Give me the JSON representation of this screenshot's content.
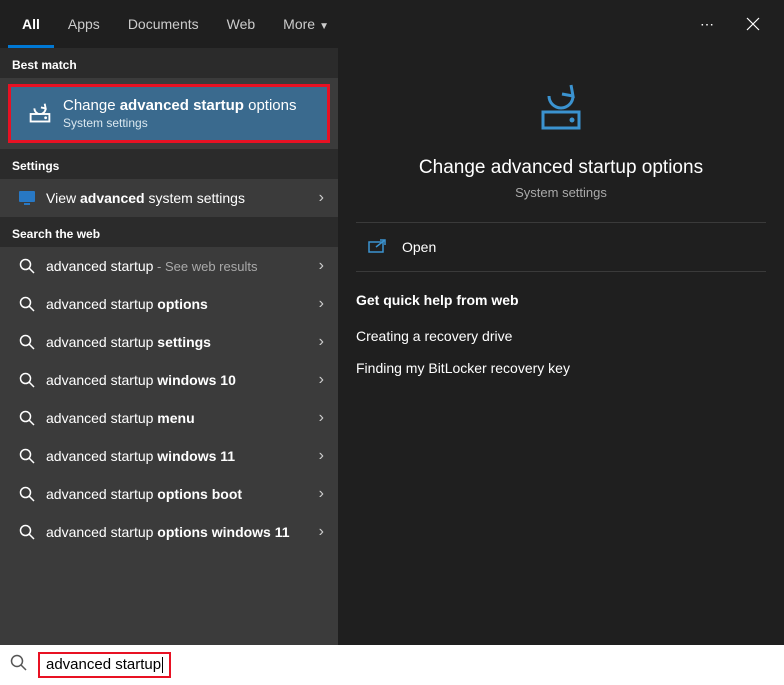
{
  "tabs": [
    "All",
    "Apps",
    "Documents",
    "Web",
    "More"
  ],
  "active_tab": "All",
  "sections": {
    "best": "Best match",
    "settings": "Settings",
    "web": "Search the web"
  },
  "best_match": {
    "title_parts": [
      [
        "Change ",
        false
      ],
      [
        "advanced startup",
        true
      ],
      [
        " options",
        false
      ]
    ],
    "subtitle": "System settings"
  },
  "settings_items": [
    {
      "parts": [
        [
          "View ",
          false
        ],
        [
          "advanced",
          true
        ],
        [
          " system settings",
          false
        ]
      ]
    }
  ],
  "web_items": [
    {
      "parts": [
        [
          "advanced startup",
          false
        ]
      ],
      "hint": " - See web results"
    },
    {
      "parts": [
        [
          "advanced startup ",
          false
        ],
        [
          "options",
          true
        ]
      ]
    },
    {
      "parts": [
        [
          "advanced startup ",
          false
        ],
        [
          "settings",
          true
        ]
      ]
    },
    {
      "parts": [
        [
          "advanced startup ",
          false
        ],
        [
          "windows 10",
          true
        ]
      ]
    },
    {
      "parts": [
        [
          "advanced startup ",
          false
        ],
        [
          "menu",
          true
        ]
      ]
    },
    {
      "parts": [
        [
          "advanced startup ",
          false
        ],
        [
          "windows 11",
          true
        ]
      ]
    },
    {
      "parts": [
        [
          "advanced startup ",
          false
        ],
        [
          "options boot",
          true
        ]
      ]
    },
    {
      "parts": [
        [
          "advanced startup ",
          false
        ],
        [
          "options windows 11",
          true
        ]
      ]
    }
  ],
  "preview": {
    "title": "Change advanced startup options",
    "subtitle": "System settings",
    "open_label": "Open",
    "help_header": "Get quick help from web",
    "help_links": [
      "Creating a recovery drive",
      "Finding my BitLocker recovery key"
    ]
  },
  "search_text": "advanced startup"
}
